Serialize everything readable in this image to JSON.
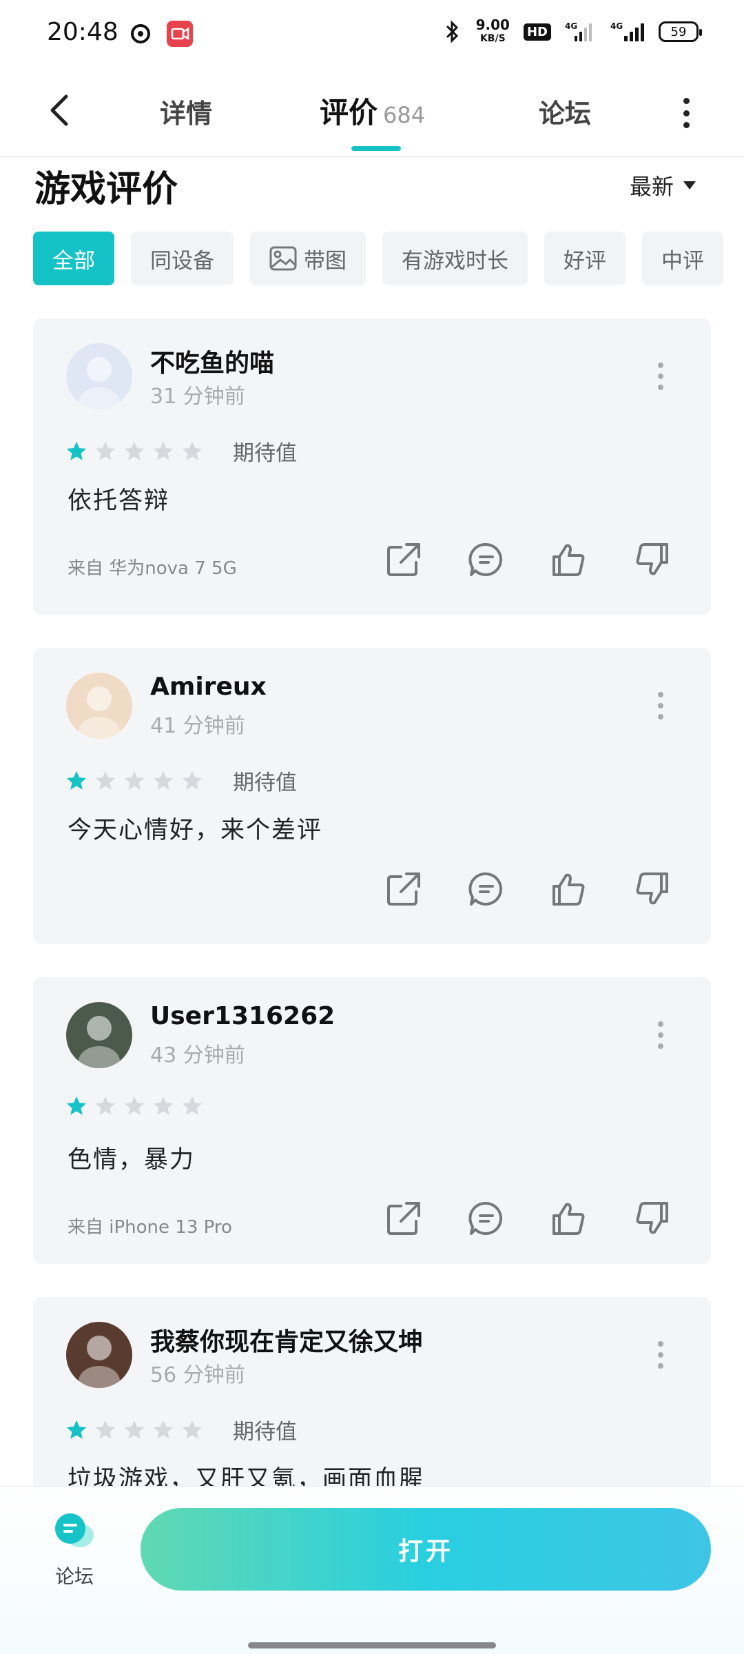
{
  "status_bar": {
    "time": "20:48",
    "net_speed": "9.00",
    "net_unit": "KB/S",
    "hd": "HD",
    "network_1": "4G",
    "network_2": "4G",
    "battery": "59"
  },
  "nav": {
    "tabs": [
      {
        "label": "详情"
      },
      {
        "label": "评价",
        "count": "684"
      },
      {
        "label": "论坛"
      }
    ]
  },
  "section": {
    "title": "游戏评价",
    "sort": "最新"
  },
  "filters": [
    "全部",
    "同设备",
    "带图",
    "有游戏时长",
    "好评",
    "中评"
  ],
  "reviews": [
    {
      "username": "不吃鱼的喵",
      "time": "31 分钟前",
      "stars": 1,
      "rating_label": "期待值",
      "text": "依托答辩",
      "device": "来自 华为nova 7 5G"
    },
    {
      "username": "Amireux",
      "time": "41 分钟前",
      "stars": 1,
      "rating_label": "期待值",
      "text": "今天心情好，来个差评",
      "device": ""
    },
    {
      "username": "User1316262",
      "time": "43 分钟前",
      "stars": 1,
      "rating_label": "",
      "text": "色情，暴力",
      "device": "来自 iPhone 13 Pro"
    },
    {
      "username": "我蔡你现在肯定又徐又坤",
      "time": "56 分钟前",
      "stars": 1,
      "rating_label": "期待值",
      "text": "垃圾游戏，又肝又氪，画面血腥",
      "device": ""
    }
  ],
  "bottom": {
    "forum_label": "论坛",
    "open_label": "打开"
  },
  "colors": {
    "accent": "#15c2c6",
    "star_empty": "#d6d8dc"
  }
}
